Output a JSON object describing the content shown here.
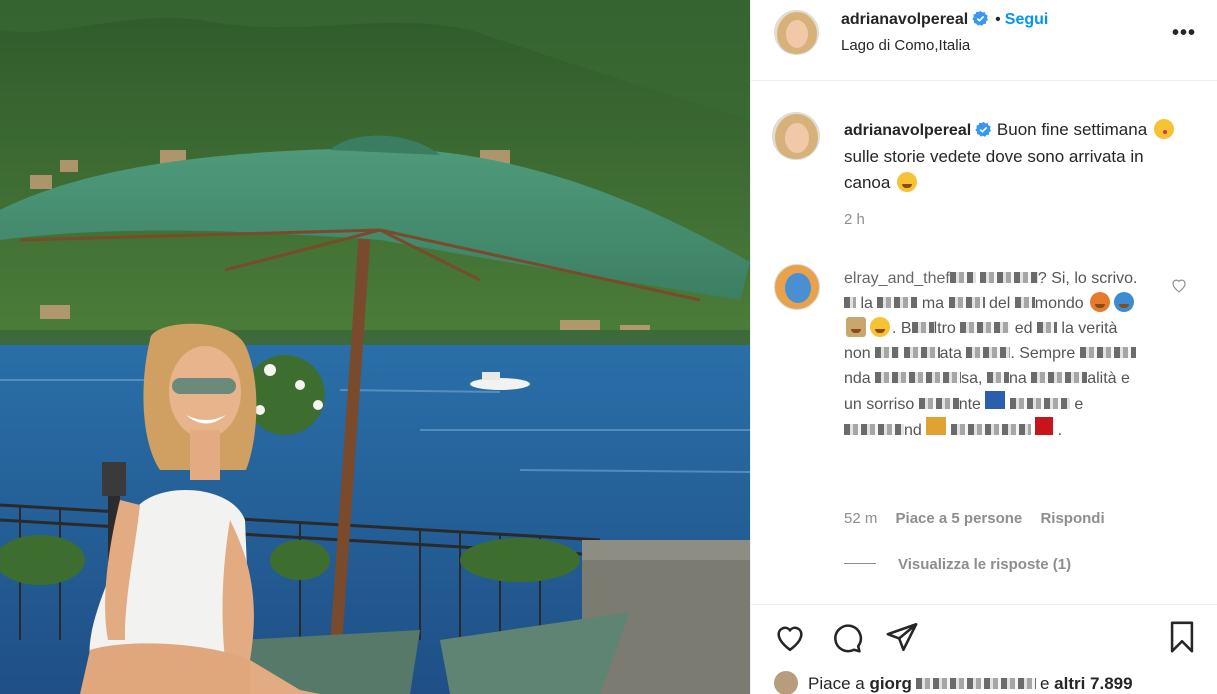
{
  "post": {
    "location": "Lago di Como,Italia",
    "colors": {
      "accent": "#0095f6",
      "muted": "#8e8e8e",
      "text": "#262626"
    }
  },
  "header": {
    "username": "adrianavolpereal",
    "separator": "•",
    "follow_label": "Segui",
    "more_label": "•••"
  },
  "caption": {
    "username": "adrianavolpereal",
    "text_part1": "Buon fine settimana",
    "text_part2": "sulle storie vedete dove sono arrivata in canoa",
    "time": "2 h"
  },
  "comment": {
    "username_visible": "elray_and_thef",
    "text_fragments": [
      "? Si, lo",
      "scrivo.",
      "la",
      "ma",
      "del",
      "mondo",
      ". B",
      "ltro",
      "ed",
      "la verità non",
      "ata",
      ". Sempre",
      "nda",
      "sa,",
      "na",
      "alità",
      "e un sorriso",
      "nte",
      "e",
      "nd"
    ],
    "time": "52 m",
    "likes": "Piace a 5 persone",
    "reply": "Rispondi",
    "view_replies": "Visualizza le risposte (1)"
  },
  "likes": {
    "prefix": "Piace a",
    "name_visible": "giorg",
    "connector": "e",
    "others": "altri 7.899"
  },
  "icons": [
    "verified-icon",
    "heart-icon",
    "comment-icon",
    "share-icon",
    "bookmark-icon",
    "more-icon"
  ]
}
